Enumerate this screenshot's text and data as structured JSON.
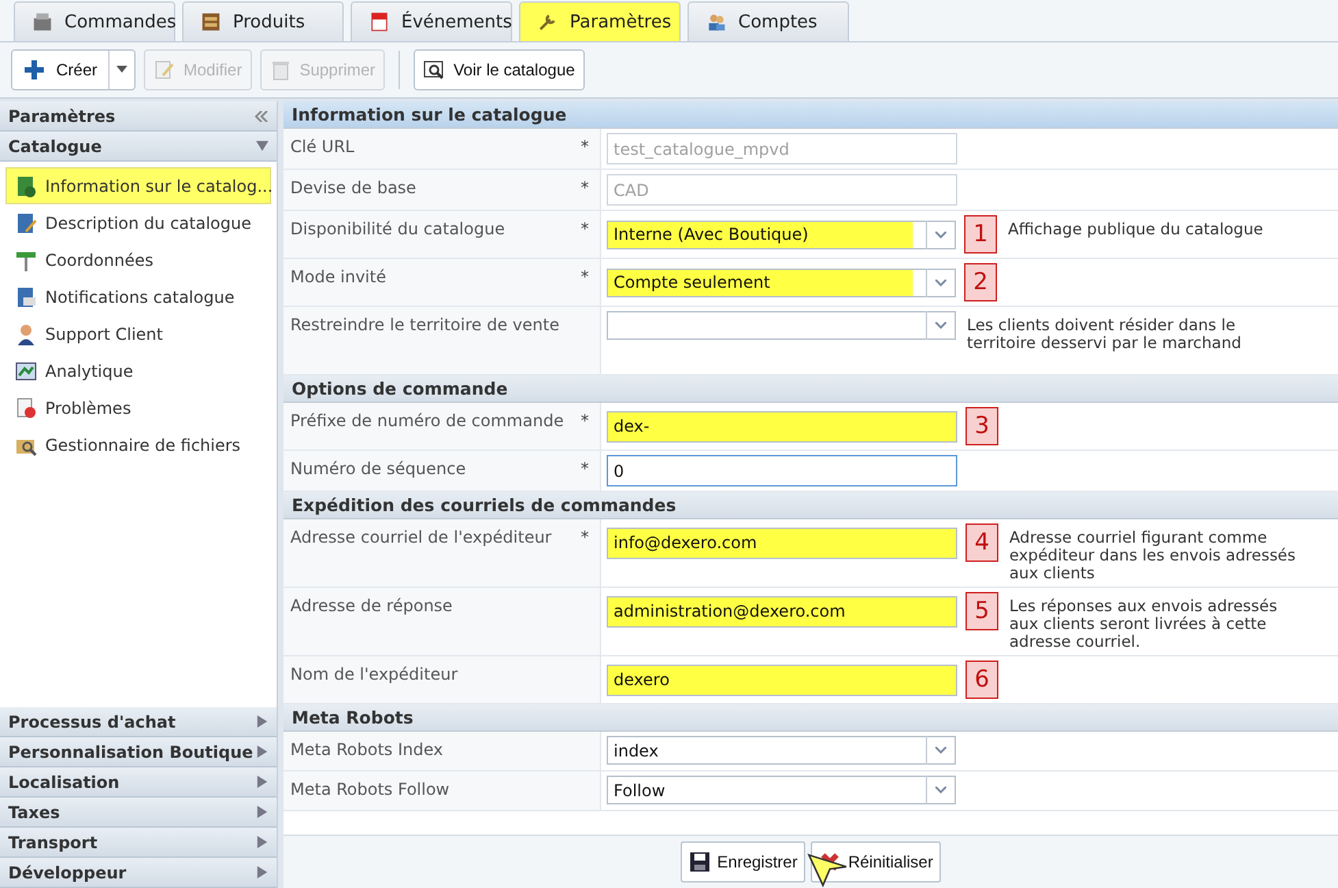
{
  "tabs": [
    {
      "label": "Commandes",
      "selected": false
    },
    {
      "label": "Produits",
      "selected": false
    },
    {
      "label": "Événements",
      "selected": false
    },
    {
      "label": "Paramètres",
      "selected": true
    },
    {
      "label": "Comptes",
      "selected": false
    }
  ],
  "toolbar": [
    {
      "label": "Créer",
      "kind": "split"
    },
    {
      "label": "Modifier",
      "disabled": true,
      "kind": "button"
    },
    {
      "label": "Supprimer",
      "disabled": true,
      "kind": "button"
    },
    {
      "label": "Voir le catalogue",
      "disabled": false,
      "kind": "button"
    }
  ],
  "sidebar": {
    "title": "Paramètres",
    "sections": [
      {
        "label": "Catalogue",
        "expanded": true,
        "items": [
          {
            "label": "Information sur le catalog...",
            "selected": true
          },
          {
            "label": "Description du catalogue",
            "selected": false
          },
          {
            "label": "Coordonnées",
            "selected": false
          },
          {
            "label": "Notifications catalogue",
            "selected": false
          },
          {
            "label": "Support Client",
            "selected": false
          },
          {
            "label": "Analytique",
            "selected": false
          },
          {
            "label": "Problèmes",
            "selected": false
          },
          {
            "label": "Gestionnaire de fichiers",
            "selected": false
          }
        ]
      },
      {
        "label": "Processus d'achat",
        "expanded": false
      },
      {
        "label": "Personnalisation Boutique",
        "expanded": false
      },
      {
        "label": "Localisation",
        "expanded": false
      },
      {
        "label": "Taxes",
        "expanded": false
      },
      {
        "label": "Transport",
        "expanded": false
      },
      {
        "label": "Développeur",
        "expanded": false
      }
    ]
  },
  "form": [
    {
      "title": "Information sur le catalogue",
      "fields": [
        {
          "label": "Clé URL",
          "mark": "*",
          "kind": "text",
          "value": "test_catalogue_mpvd",
          "disabled": true,
          "highlighted": false
        },
        {
          "label": "Devise de base",
          "mark": "*",
          "kind": "text",
          "value": "CAD",
          "disabled": true,
          "highlighted": false
        },
        {
          "label": "Disponibilité du catalogue",
          "mark": "*",
          "kind": "select",
          "value": "Interne (Avec Boutique)",
          "highlighted": true,
          "callout": "1",
          "note": "Affichage publique du catalogue"
        },
        {
          "label": "Mode invité",
          "mark": "*",
          "kind": "select",
          "value": "Compte seulement",
          "highlighted": true,
          "callout": "2"
        },
        {
          "label": "Restreindre le territoire de vente",
          "kind": "select",
          "highlighted": false,
          "note": "Les clients doivent résider dans le territoire desservi par le marchand"
        }
      ]
    },
    {
      "title": "Options de commande",
      "fields": [
        {
          "label": "Préfixe de numéro de commande",
          "mark": "*",
          "kind": "text",
          "value": "dex-",
          "disabled": false,
          "highlighted": true,
          "callout": "3"
        },
        {
          "label": "Numéro de séquence",
          "mark": "*",
          "kind": "text",
          "value": "0",
          "disabled": false,
          "highlighted": false,
          "focused": true
        }
      ]
    },
    {
      "title": "Expédition des courriels de commandes",
      "fields": [
        {
          "label": "Adresse courriel de l'expéditeur",
          "mark": "*",
          "kind": "text",
          "value": "info@dexero.com",
          "disabled": false,
          "highlighted": true,
          "callout": "4",
          "note": "Adresse courriel figurant comme expéditeur dans les envois adressés aux clients"
        },
        {
          "label": "Adresse de réponse",
          "kind": "text",
          "value": "administration@dexero.com",
          "disabled": false,
          "highlighted": true,
          "callout": "5",
          "note": "Les réponses aux envois adressés aux clients seront livrées à cette adresse courriel."
        },
        {
          "label": "Nom de l'expéditeur",
          "kind": "text",
          "value": "dexero",
          "disabled": false,
          "highlighted": true,
          "callout": "6"
        }
      ]
    },
    {
      "title": "Meta Robots",
      "fields": [
        {
          "label": "Meta Robots Index",
          "kind": "select",
          "value": "index",
          "highlighted": false
        },
        {
          "label": "Meta Robots Follow",
          "kind": "select",
          "value": "Follow",
          "highlighted": false
        }
      ]
    }
  ],
  "footer": [
    {
      "label": "Enregistrer"
    },
    {
      "label": "Réinitialiser"
    }
  ]
}
